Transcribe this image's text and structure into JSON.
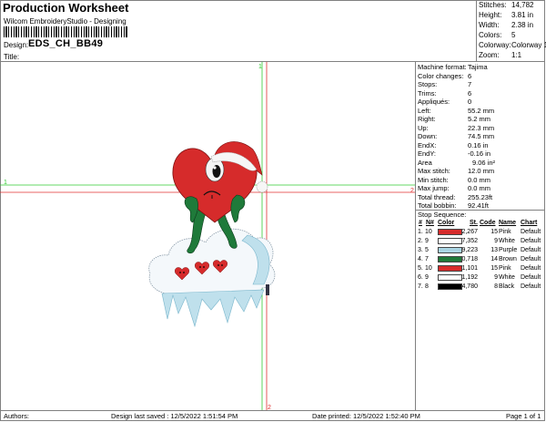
{
  "header": {
    "title": "Production Worksheet",
    "subtitle": "Wilcom EmbroideryStudio - Designing",
    "design_label": "Design:",
    "design_value": "EDS_CH_BB49",
    "title_label": "Title:"
  },
  "stats": [
    {
      "label": "Stitches:",
      "value": "14,782"
    },
    {
      "label": "Height:",
      "value": "3.81 in"
    },
    {
      "label": "Width:",
      "value": "2.38 in"
    },
    {
      "label": "Colors:",
      "value": "5"
    },
    {
      "label": "Colorway:",
      "value": "Colorway 1"
    },
    {
      "label": "Zoom:",
      "value": "1:1"
    }
  ],
  "details": [
    {
      "label": "Machine format:",
      "value": "Tajima"
    },
    {
      "label": "Color changes:",
      "value": "6"
    },
    {
      "label": "Stops:",
      "value": "7"
    },
    {
      "label": "Trims:",
      "value": "6"
    },
    {
      "label": "Appliqués:",
      "value": "0"
    },
    {
      "label": "Left:",
      "value": "55.2 mm"
    },
    {
      "label": "Right:",
      "value": "5.2 mm"
    },
    {
      "label": "Up:",
      "value": "22.3 mm"
    },
    {
      "label": "Down:",
      "value": "74.5 mm"
    },
    {
      "label": "EndX:",
      "value": "0.16 in"
    },
    {
      "label": "EndY:",
      "value": "-0.16 in"
    },
    {
      "label": "Area",
      "value": "9.06 in²"
    },
    {
      "label": "Max stitch:",
      "value": "12.0 mm"
    },
    {
      "label": "Min stitch:",
      "value": "0.0 mm"
    },
    {
      "label": "Max jump:",
      "value": "0.0 mm"
    },
    {
      "label": "Total thread:",
      "value": "255.23ft"
    },
    {
      "label": "Total bobbin:",
      "value": "92.41ft"
    }
  ],
  "sequence": {
    "heading": "Stop Sequence:",
    "columns": [
      "#",
      "N#",
      "Color",
      "St.",
      "Code",
      "Name",
      "Chart"
    ],
    "rows": [
      {
        "num": "1.",
        "needle": "10",
        "color": "#d62b2b",
        "stitches": "2,267",
        "code": "15",
        "name": "Pink",
        "chart": "Default"
      },
      {
        "num": "2.",
        "needle": "9",
        "color": "#ffffff",
        "stitches": "7,352",
        "code": "9",
        "name": "White",
        "chart": "Default"
      },
      {
        "num": "3.",
        "needle": "5",
        "color": "#a9d4e2",
        "stitches": "9,223",
        "code": "13",
        "name": "Purple",
        "chart": "Default"
      },
      {
        "num": "4.",
        "needle": "7",
        "color": "#1f7a3a",
        "stitches": "10,718",
        "code": "14",
        "name": "Brown",
        "chart": "Default"
      },
      {
        "num": "5.",
        "needle": "10",
        "color": "#d62b2b",
        "stitches": "11,101",
        "code": "15",
        "name": "Pink",
        "chart": "Default"
      },
      {
        "num": "6.",
        "needle": "9",
        "color": "#ffffff",
        "stitches": "11,192",
        "code": "9",
        "name": "White",
        "chart": "Default"
      },
      {
        "num": "7.",
        "needle": "8",
        "color": "#000000",
        "stitches": "14,780",
        "code": "8",
        "name": "Black",
        "chart": "Default"
      }
    ]
  },
  "canvas": {
    "marker_top": "1",
    "marker_left": "1",
    "marker_right": "2",
    "marker_bottom": "2"
  },
  "footer": {
    "authors": "Authors:",
    "last_saved": "Design last saved : 12/5/2022 1:51:54 PM",
    "printed": "Date printed: 12/5/2022 1:52:40 PM",
    "page": "Page 1 of 1"
  },
  "colors": {
    "guide_green": "#33cc33",
    "guide_red": "#e03030",
    "border": "#808080"
  }
}
